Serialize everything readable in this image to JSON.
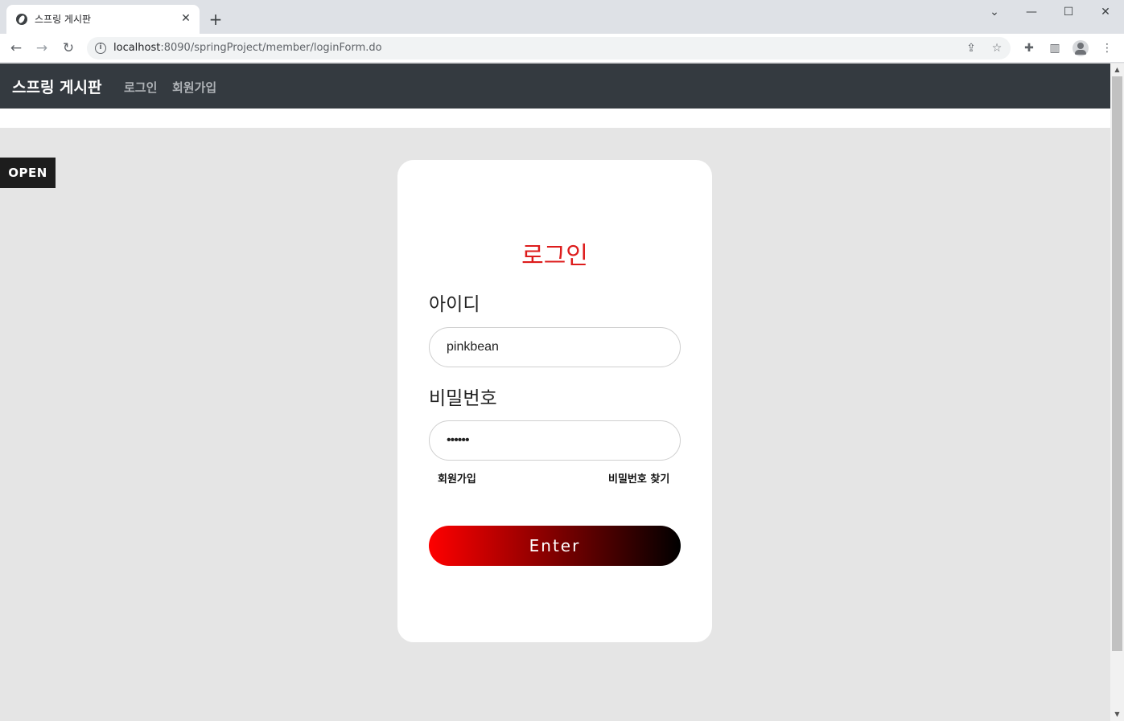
{
  "browser": {
    "tab_title": "스프링 게시판",
    "tab_close": "✕",
    "new_tab": "+",
    "url_host": "localhost",
    "url_rest": ":8090/springProject/member/loginForm.do",
    "window": {
      "dropdown": "⌄",
      "minimize": "—",
      "maximize": "☐",
      "close": "✕"
    }
  },
  "navbar": {
    "brand": "스프링 게시판",
    "links": [
      "로그인",
      "회원가입"
    ]
  },
  "sidebar_toggle": {
    "label": "OPEN"
  },
  "login": {
    "title": "로그인",
    "id_label": "아이디",
    "id_value": "pinkbean",
    "pw_label": "비밀번호",
    "pw_value": "••••••",
    "signup_link": "회원가입",
    "find_pw_link": "비밀번호 찾기",
    "submit": "Enter"
  },
  "colors": {
    "navbar_bg": "#343a40",
    "title_red": "#dd1c1c",
    "button_gradient_start": "#ff0000",
    "button_gradient_end": "#000000",
    "page_bg": "#e5e5e5"
  }
}
